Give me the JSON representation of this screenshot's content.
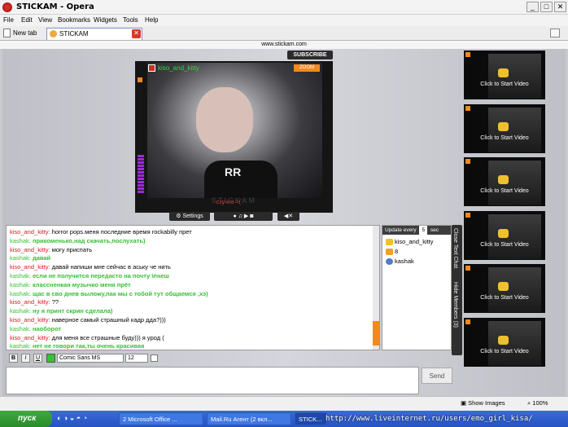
{
  "window": {
    "title": "STICKAM - Opera"
  },
  "menu": [
    "File",
    "Edit",
    "View",
    "Bookmarks",
    "Widgets",
    "Tools",
    "Help"
  ],
  "tabs": {
    "new_tab": "New tab",
    "active_tab": "STICKAM"
  },
  "address": {
    "url": "www.stickam.com"
  },
  "player": {
    "subscribe_label": "SUBSCRIBE",
    "user": "kiso_and_kitty",
    "zoom_label": "ZOOM",
    "caption": "скучно =(",
    "brand": "STICKAM",
    "shirt_text": "RR",
    "controls": {
      "settings_label": "Settings"
    }
  },
  "chat": {
    "lines": [
      {
        "user": "kiso_and_kitty",
        "sep": ": ",
        "text": "horror pops.меня последние время rockabilly прет",
        "user_color": "red",
        "text_style": "plain"
      },
      {
        "user": "kashak",
        "sep": ": ",
        "text": "прикоменько,над скачать,послухать)",
        "user_color": "green",
        "text_style": "green"
      },
      {
        "user": "kiso_and_kitty",
        "sep": ": ",
        "text": "могу приспать",
        "user_color": "red",
        "text_style": "plain"
      },
      {
        "user": "kashak",
        "sep": ": ",
        "text": "давай",
        "user_color": "green",
        "text_style": "green"
      },
      {
        "user": "kiso_and_kitty",
        "sep": ": ",
        "text": "давай напиши мне сейчас в аську че нить",
        "user_color": "red",
        "text_style": "plain"
      },
      {
        "user": "kashak",
        "sep": ": ",
        "text": "если не получится передасто на почту \\пнеш",
        "user_color": "green",
        "text_style": "green"
      },
      {
        "user": "kashak",
        "sep": ": ",
        "text": "классненкая музычко меня прёт",
        "user_color": "green",
        "text_style": "green"
      },
      {
        "user": "kashak",
        "sep": ": ",
        "text": "щас в сво днев выложу,пак мы с тобой тут общаемся ,хэ)",
        "user_color": "green",
        "text_style": "green"
      },
      {
        "user": "kiso_and_kitty",
        "sep": ": ",
        "text": "??",
        "user_color": "red",
        "text_style": "plain"
      },
      {
        "user": "kashak",
        "sep": ": ",
        "text": "ну я принт скрин сделала)",
        "user_color": "green",
        "text_style": "green"
      },
      {
        "user": "kiso_and_kitty",
        "sep": ": ",
        "text": "наверное самый страшный кадр дда?)))",
        "user_color": "red",
        "text_style": "plain"
      },
      {
        "user": "kashak",
        "sep": ": ",
        "text": "наоборот",
        "user_color": "green",
        "text_style": "green"
      },
      {
        "user": "kiso_and_kitty",
        "sep": ": ",
        "text": "для меня все страшные буду))) я урод (",
        "user_color": "red",
        "text_style": "plain"
      },
      {
        "user": "kashak",
        "sep": ": ",
        "text": "нет не говори так,ты очень красивая",
        "user_color": "green",
        "text_style": "green"
      }
    ]
  },
  "members": {
    "update_label": "Update every",
    "interval": "5",
    "unit": "sec",
    "list": [
      "kiso_and_kitty",
      "8",
      "kashak"
    ]
  },
  "sidetabs": {
    "close": "Close Text Chat",
    "hide": "Hide Members (3)"
  },
  "videos": {
    "start_label": "Click to Start Video"
  },
  "format": {
    "bold": "B",
    "italic": "I",
    "underline": "U",
    "font": "Comic Sans MS",
    "size": "12"
  },
  "send_label": "Send",
  "status": {
    "show_images": "Show Images",
    "zoom": "100%"
  },
  "taskbar": {
    "start": "пуск",
    "tasks": [
      "2 Microsoft Office ...",
      "Mail.Ru Агент (2 вкл...",
      "STICK..."
    ],
    "watermark": "http://www.liveinternet.ru/users/emo_girl_kisa/"
  },
  "colors": {
    "accent": "#f08a20",
    "chat_red": "#d21d1d",
    "chat_green": "#36c136"
  }
}
